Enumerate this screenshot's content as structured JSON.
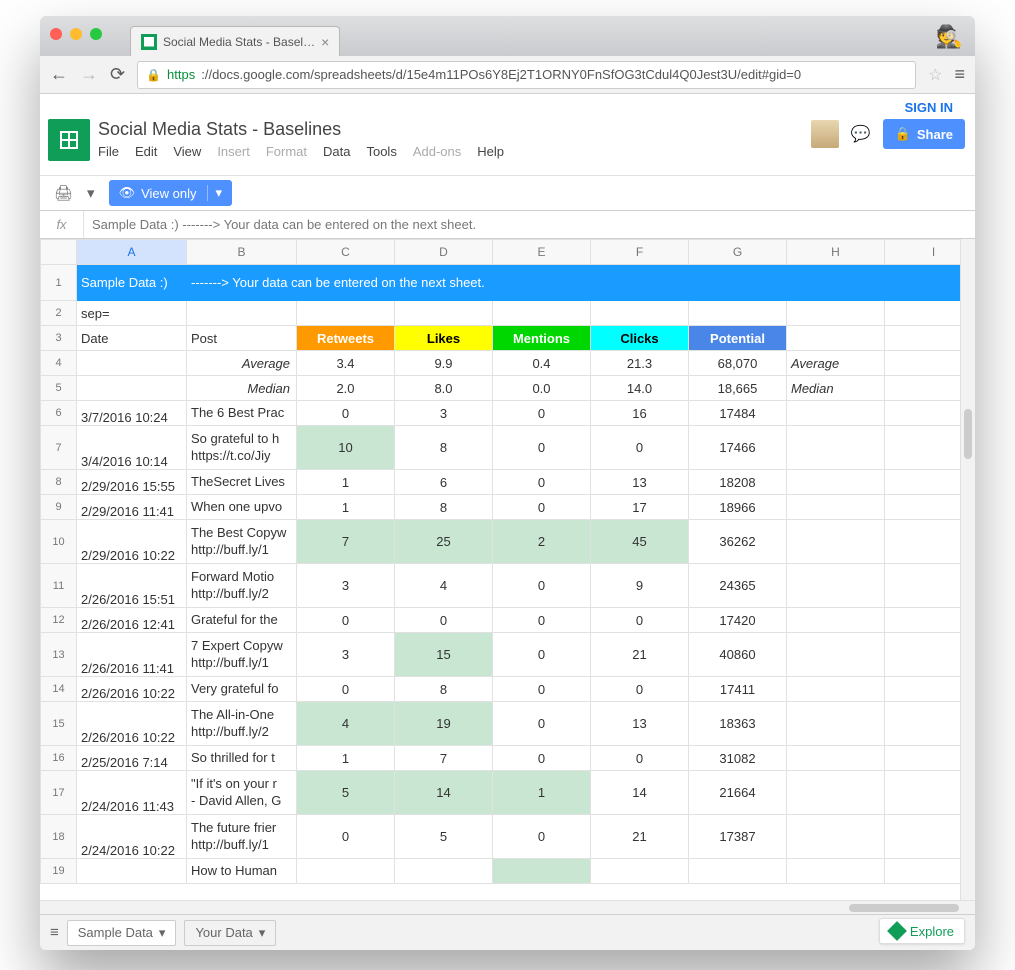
{
  "browser": {
    "tab_title": "Social Media Stats - Basel…",
    "url_proto": "https",
    "url_rest": "://docs.google.com/spreadsheets/d/15e4m11POs6Y8Ej2T1ORNY0FnSfOG3tCdul4Q0Jest3U/edit#gid=0"
  },
  "docs": {
    "title": "Social Media Stats - Baselines",
    "menus": [
      "File",
      "Edit",
      "View",
      "Insert",
      "Format",
      "Data",
      "Tools",
      "Add-ons",
      "Help"
    ],
    "menu_disabled": [
      "Insert",
      "Format",
      "Add-ons"
    ],
    "signin": "SIGN IN",
    "share": "Share",
    "view_only": "View only"
  },
  "formula_bar": "Sample Data :)  ------->  Your data can be entered on the next sheet.",
  "columns": [
    "A",
    "B",
    "C",
    "D",
    "E",
    "F",
    "G",
    "H",
    "I"
  ],
  "row1": {
    "a": "Sample Data :)",
    "b": "------->  Your data can be entered on the next sheet."
  },
  "row2_a": "sep=",
  "headers": {
    "date": "Date",
    "post": "Post",
    "retweets": "Retweets",
    "likes": "Likes",
    "mentions": "Mentions",
    "clicks": "Clicks",
    "potential": "Potential"
  },
  "avg_label": "Average",
  "med_label": "Median",
  "avg": {
    "retweets": "3.4",
    "likes": "9.9",
    "mentions": "0.4",
    "clicks": "21.3",
    "potential": "68,070"
  },
  "med": {
    "retweets": "2.0",
    "likes": "8.0",
    "mentions": "0.0",
    "clicks": "14.0",
    "potential": "18,665"
  },
  "rows": [
    {
      "n": 6,
      "date": "3/7/2016 10:24",
      "post": "The 6 Best Prac",
      "rt": "0",
      "lk": "3",
      "mn": "0",
      "ck": "16",
      "pt": "17484",
      "hl": []
    },
    {
      "n": 7,
      "date": "3/4/2016 10:14",
      "post": "So grateful to h\nhttps://t.co/Jiy",
      "rt": "10",
      "lk": "8",
      "mn": "0",
      "ck": "0",
      "pt": "17466",
      "hl": [
        "rt"
      ],
      "tall": true
    },
    {
      "n": 8,
      "date": "2/29/2016 15:55",
      "post": "TheSecret Lives",
      "rt": "1",
      "lk": "6",
      "mn": "0",
      "ck": "13",
      "pt": "18208",
      "hl": []
    },
    {
      "n": 9,
      "date": "2/29/2016 11:41",
      "post": "When one upvo",
      "rt": "1",
      "lk": "8",
      "mn": "0",
      "ck": "17",
      "pt": "18966",
      "hl": []
    },
    {
      "n": 10,
      "date": "2/29/2016 10:22",
      "post": "The Best Copyw\nhttp://buff.ly/1",
      "rt": "7",
      "lk": "25",
      "mn": "2",
      "ck": "45",
      "pt": "36262",
      "hl": [
        "rt",
        "lk",
        "mn",
        "ck"
      ],
      "tall": true
    },
    {
      "n": 11,
      "date": "2/26/2016 15:51",
      "post": "Forward Motio\nhttp://buff.ly/2",
      "rt": "3",
      "lk": "4",
      "mn": "0",
      "ck": "9",
      "pt": "24365",
      "hl": [],
      "tall": true
    },
    {
      "n": 12,
      "date": "2/26/2016 12:41",
      "post": "Grateful for the",
      "rt": "0",
      "lk": "0",
      "mn": "0",
      "ck": "0",
      "pt": "17420",
      "hl": []
    },
    {
      "n": 13,
      "date": "2/26/2016 11:41",
      "post": "7 Expert Copyw\nhttp://buff.ly/1",
      "rt": "3",
      "lk": "15",
      "mn": "0",
      "ck": "21",
      "pt": "40860",
      "hl": [
        "lk"
      ],
      "tall": true
    },
    {
      "n": 14,
      "date": "2/26/2016 10:22",
      "post": "Very grateful fo",
      "rt": "0",
      "lk": "8",
      "mn": "0",
      "ck": "0",
      "pt": "17411",
      "hl": []
    },
    {
      "n": 15,
      "date": "2/26/2016 10:22",
      "post": "The All-in-One \nhttp://buff.ly/2",
      "rt": "4",
      "lk": "19",
      "mn": "0",
      "ck": "13",
      "pt": "18363",
      "hl": [
        "rt",
        "lk"
      ],
      "tall": true
    },
    {
      "n": 16,
      "date": "2/25/2016 7:14",
      "post": "So thrilled for t",
      "rt": "1",
      "lk": "7",
      "mn": "0",
      "ck": "0",
      "pt": "31082",
      "hl": []
    },
    {
      "n": 17,
      "date": "2/24/2016 11:43",
      "post": "\"If it's on your r\n- David Allen, G",
      "rt": "5",
      "lk": "14",
      "mn": "1",
      "ck": "14",
      "pt": "21664",
      "hl": [
        "rt",
        "lk",
        "mn"
      ],
      "tall": true
    },
    {
      "n": 18,
      "date": "2/24/2016 10:22",
      "post": "The future frier\nhttp://buff.ly/1",
      "rt": "0",
      "lk": "5",
      "mn": "0",
      "ck": "21",
      "pt": "17387",
      "hl": [],
      "tall": true
    },
    {
      "n": 19,
      "date": "",
      "post": "How to Human",
      "rt": "",
      "lk": "",
      "mn": "",
      "ck": "",
      "pt": "",
      "hl": [
        "mn"
      ]
    }
  ],
  "sheet_tabs": {
    "active": "Sample Data",
    "inactive": "Your Data"
  },
  "explore": "Explore"
}
